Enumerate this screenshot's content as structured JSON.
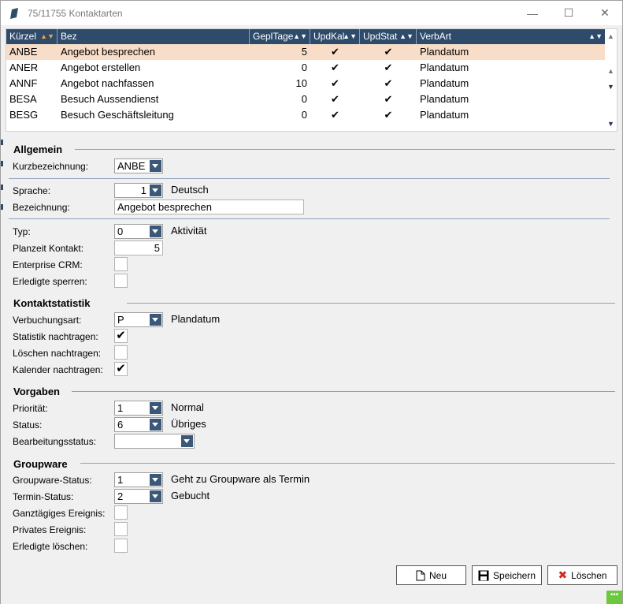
{
  "window": {
    "title": "75/11755 Kontaktarten",
    "minimize_glyph": "—",
    "maximize_glyph": "☐",
    "close_glyph": "✕"
  },
  "grid": {
    "columns": [
      "Kürzel",
      "Bez",
      "GeplTage",
      "UpdKal",
      "UpdStat",
      "VerbArt"
    ],
    "rows": [
      {
        "kuerzel": "ANBE",
        "bez": "Angebot besprechen",
        "gepltage": "5",
        "updkal": "✔",
        "updstat": "✔",
        "verbart": "Plandatum"
      },
      {
        "kuerzel": "ANER",
        "bez": "Angebot erstellen",
        "gepltage": "0",
        "updkal": "✔",
        "updstat": "✔",
        "verbart": "Plandatum"
      },
      {
        "kuerzel": "ANNF",
        "bez": "Angebot nachfassen",
        "gepltage": "10",
        "updkal": "✔",
        "updstat": "✔",
        "verbart": "Plandatum"
      },
      {
        "kuerzel": "BESA",
        "bez": "Besuch Aussendienst",
        "gepltage": "0",
        "updkal": "✔",
        "updstat": "✔",
        "verbart": "Plandatum"
      },
      {
        "kuerzel": "BESG",
        "bez": "Besuch Geschäftsleitung",
        "gepltage": "0",
        "updkal": "✔",
        "updstat": "✔",
        "verbart": "Plandatum"
      }
    ],
    "selected_row": 0
  },
  "allgemein": {
    "title": "Allgemein",
    "kurzbezeichnung_label": "Kurzbezeichnung:",
    "kurzbezeichnung_value": "ANBE",
    "sprache_label": "Sprache:",
    "sprache_value": "1",
    "sprache_desc": "Deutsch",
    "bezeichnung_label": "Bezeichnung:",
    "bezeichnung_value": "Angebot besprechen",
    "typ_label": "Typ:",
    "typ_value": "0",
    "typ_desc": "Aktivität",
    "planzeit_label": "Planzeit Kontakt:",
    "planzeit_value": "5",
    "enterprise_label": "Enterprise CRM:",
    "enterprise_checked": "",
    "erledigte_sperren_label": "Erledigte sperren:",
    "erledigte_sperren_checked": ""
  },
  "kontaktstatistik": {
    "title": "Kontaktstatistik",
    "verbuchungsart_label": "Verbuchungsart:",
    "verbuchungsart_value": "P",
    "verbuchungsart_desc": "Plandatum",
    "statistik_label": "Statistik nachtragen:",
    "statistik_checked": "✔",
    "loeschen_label": "Löschen nachtragen:",
    "loeschen_checked": "",
    "kalender_label": "Kalender nachtragen:",
    "kalender_checked": "✔"
  },
  "vorgaben": {
    "title": "Vorgaben",
    "prioritaet_label": "Priorität:",
    "prioritaet_value": "1",
    "prioritaet_desc": "Normal",
    "status_label": "Status:",
    "status_value": "6",
    "status_desc": "Übriges",
    "bearbeitung_label": "Bearbeitungsstatus:",
    "bearbeitung_value": ""
  },
  "groupware": {
    "title": "Groupware",
    "gw_status_label": "Groupware-Status:",
    "gw_status_value": "1",
    "gw_status_desc": "Geht zu Groupware als Termin",
    "termin_label": "Termin-Status:",
    "termin_value": "2",
    "termin_desc": "Gebucht",
    "ganztaegig_label": "Ganztägiges Ereignis:",
    "ganztaegig_checked": "",
    "privat_label": "Privates Ereignis:",
    "privat_checked": "",
    "erledigte_loeschen_label": "Erledigte löschen:",
    "erledigte_loeschen_checked": ""
  },
  "buttons": {
    "neu": "Neu",
    "speichern": "Speichern",
    "loeschen": "Löschen"
  },
  "colors": {
    "header_bg": "#2e4b6c",
    "selected_row": "#f8dec9",
    "grip": "#6cc93b"
  }
}
